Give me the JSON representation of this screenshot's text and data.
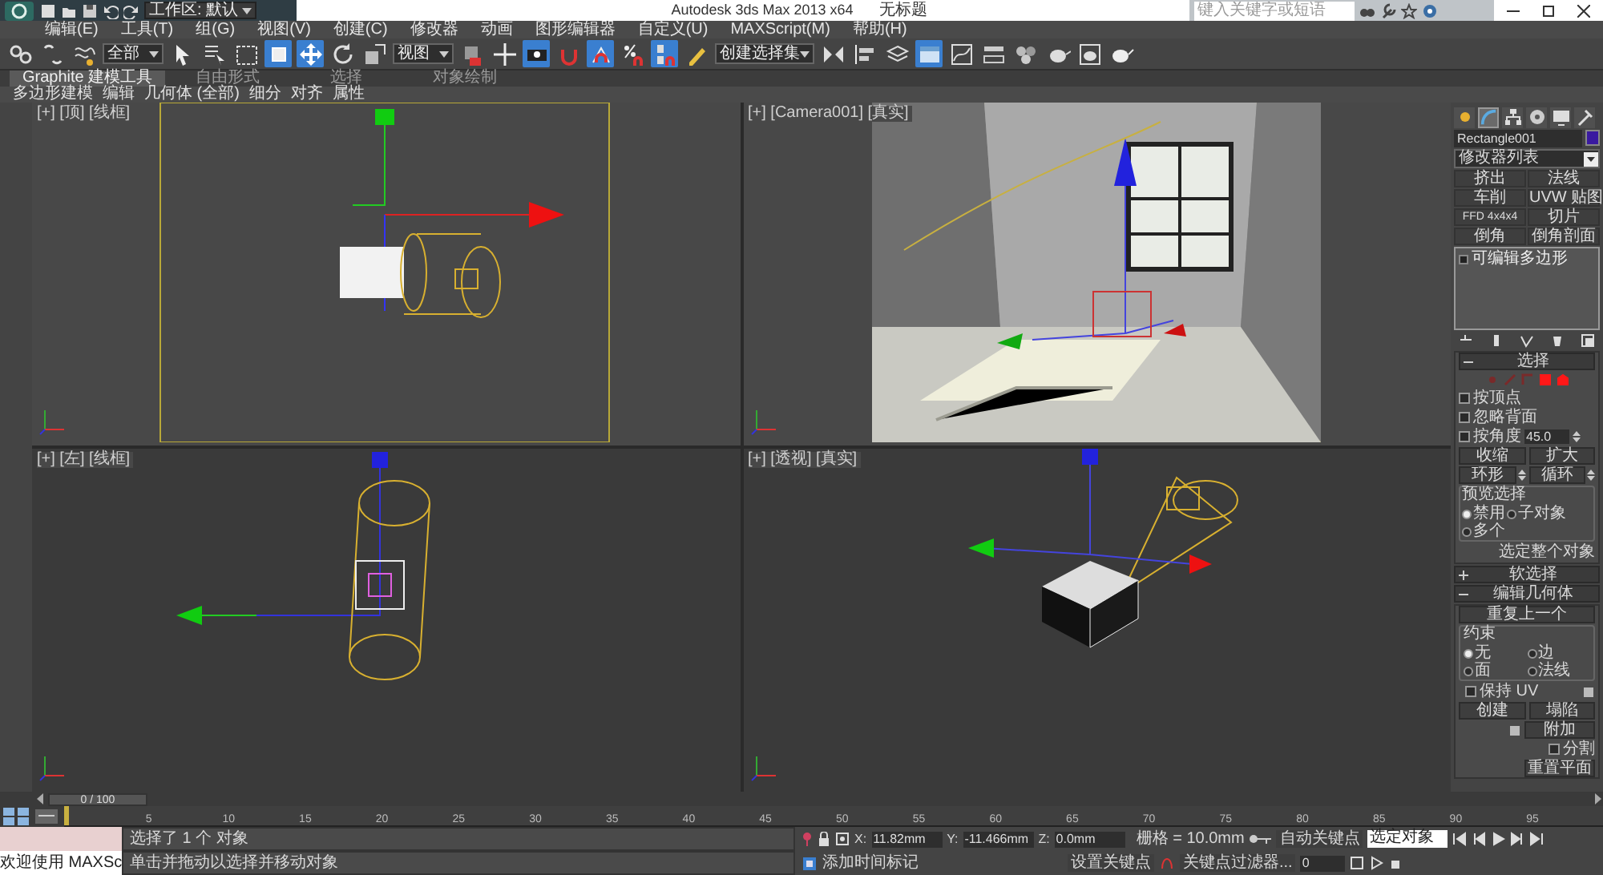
{
  "title_bar": {
    "workspace": "工作区: 默认",
    "app_title": "Autodesk 3ds Max  2013 x64",
    "document": "无标题",
    "search": {
      "placeholder": "键入关键字或短语"
    }
  },
  "menu": [
    "编辑(E)",
    "工具(T)",
    "组(G)",
    "视图(V)",
    "创建(C)",
    "修改器",
    "动画",
    "图形编辑器",
    "自定义(U)",
    "MAXScript(M)",
    "帮助(H)"
  ],
  "toolbar": [
    {
      "kind": "link",
      "active": false
    },
    {
      "kind": "unlink",
      "active": false
    },
    {
      "kind": "bind",
      "active": false
    },
    {
      "kind": "dropdown",
      "value": "全部"
    },
    {
      "kind": "select",
      "active": false
    },
    {
      "kind": "select_by_name",
      "active": false
    },
    {
      "kind": "region",
      "active": false
    },
    {
      "kind": "window",
      "active": true
    },
    {
      "kind": "move",
      "active": true
    },
    {
      "kind": "rotate",
      "active": false
    },
    {
      "kind": "scale",
      "active": false
    },
    {
      "kind": "dropdown",
      "value": "视图"
    },
    {
      "kind": "pivot",
      "active": false
    },
    {
      "kind": "manipulate",
      "active": false
    },
    {
      "kind": "keyboard",
      "active": true
    },
    {
      "kind": "snap",
      "active": false
    },
    {
      "kind": "angle_snap",
      "active": true
    },
    {
      "kind": "percent_snap",
      "active": false
    },
    {
      "kind": "spinner_snap",
      "active": true
    },
    {
      "kind": "edit_named",
      "active": false
    },
    {
      "kind": "dropdown",
      "value": "创建选择集"
    },
    {
      "kind": "mirror",
      "active": false
    },
    {
      "kind": "align",
      "active": false
    },
    {
      "kind": "layers",
      "active": false
    },
    {
      "kind": "ribbon",
      "active": true
    },
    {
      "kind": "curve",
      "active": false
    },
    {
      "kind": "schematic",
      "active": false
    },
    {
      "kind": "material",
      "active": false
    },
    {
      "kind": "render_setup",
      "active": false
    },
    {
      "kind": "frame",
      "active": false
    },
    {
      "kind": "render",
      "active": false
    }
  ],
  "ribbon": {
    "tabs": [
      {
        "label": "Graphite 建模工具",
        "selected": true
      },
      {
        "label": "自由形式",
        "selected": false
      },
      {
        "label": "选择",
        "selected": false
      },
      {
        "label": "对象绘制",
        "selected": false
      }
    ],
    "panels": [
      "多边形建模",
      "编辑",
      "几何体 (全部)",
      "细分",
      "对齐",
      "属性"
    ]
  },
  "viewports": [
    {
      "kind": "top",
      "label": "[+] [顶] [线框]"
    },
    {
      "kind": "camera",
      "label": "[+] [Camera001] [真实]"
    },
    {
      "kind": "left",
      "label": "[+] [左] [线框]"
    },
    {
      "kind": "perspective",
      "label": "[+] [透视] [真实]"
    }
  ],
  "command_panel": {
    "tabs": [
      {
        "kind": "create",
        "selected": false
      },
      {
        "kind": "modify",
        "selected": true
      },
      {
        "kind": "hierarchy",
        "selected": false
      },
      {
        "kind": "motion",
        "selected": false
      },
      {
        "kind": "display",
        "selected": false
      },
      {
        "kind": "utilities",
        "selected": false
      }
    ],
    "object_name": "Rectangle001",
    "modifier_list": "修改器列表",
    "modifier_buttons": [
      "挤出",
      "法线",
      "车削",
      "UVW 贴图",
      "FFD 4x4x4",
      "切片",
      "倒角",
      "倒角剖面"
    ],
    "stack": [
      "可编辑多边形"
    ],
    "selection": {
      "title": "选择",
      "subobjects": [
        {
          "kind": "vertex",
          "enabled": false
        },
        {
          "kind": "edge",
          "enabled": false
        },
        {
          "kind": "border",
          "enabled": false
        },
        {
          "kind": "polygon",
          "enabled": true
        },
        {
          "kind": "element",
          "enabled": true
        }
      ],
      "checkboxes": [
        {
          "label": "按顶点",
          "checked": false
        },
        {
          "label": "忽略背面",
          "checked": false
        },
        {
          "label": "按角度",
          "checked": false
        }
      ],
      "angle": "45.0",
      "buttons": [
        "收缩",
        "扩大"
      ],
      "spinner_buttons": [
        "环形",
        "循环"
      ],
      "preview": {
        "title": "预览选择",
        "options": [
          {
            "label": "禁用",
            "selected": true
          },
          {
            "label": "子对象",
            "selected": false
          },
          {
            "label": "多个",
            "selected": false
          }
        ]
      },
      "info": "选定整个对象"
    },
    "rollouts": [
      {
        "title": "软选择",
        "expanded": false
      },
      {
        "title": "编辑几何体",
        "expanded": true
      }
    ],
    "edit_geometry": {
      "repeat": "重复上一个",
      "constraints": {
        "title": "约束",
        "options": [
          {
            "label": "无",
            "selected": true
          },
          {
            "label": "边",
            "selected": false
          },
          {
            "label": "面",
            "selected": false
          },
          {
            "label": "法线",
            "selected": false
          }
        ]
      },
      "keep_uv": {
        "label": "保持 UV",
        "checked": false
      },
      "buttons": [
        "创建",
        "塌陷"
      ],
      "attach": "附加",
      "split": {
        "label": "分割",
        "checked": false
      },
      "reset": "重置平面"
    }
  },
  "timeline": {
    "slider": {
      "text": "0 / 100",
      "level": 0
    },
    "ticks": [
      "5",
      "10",
      "15",
      "20",
      "25",
      "30",
      "35",
      "40",
      "45",
      "50",
      "55",
      "60",
      "65",
      "70",
      "75",
      "80",
      "85",
      "90",
      "95"
    ]
  },
  "status": {
    "maxscript": "欢迎使用 MAXSc",
    "messages": [
      "选择了 1 个 对象",
      "单击并拖动以选择并移动对象"
    ],
    "coordinates": [
      {
        "label": "X:",
        "value": "11.82mm"
      },
      {
        "label": "Y:",
        "value": "-11.466mm"
      },
      {
        "label": "Z:",
        "value": "0.0mm"
      }
    ],
    "grid": "栅格 = 10.0mm",
    "add_time_tag": "添加时间标记",
    "auto_key": "自动关键点",
    "key_mode": "选定对象",
    "set_key": "设置关键点",
    "key_filters": "关键点过滤器...",
    "frame": "0"
  }
}
